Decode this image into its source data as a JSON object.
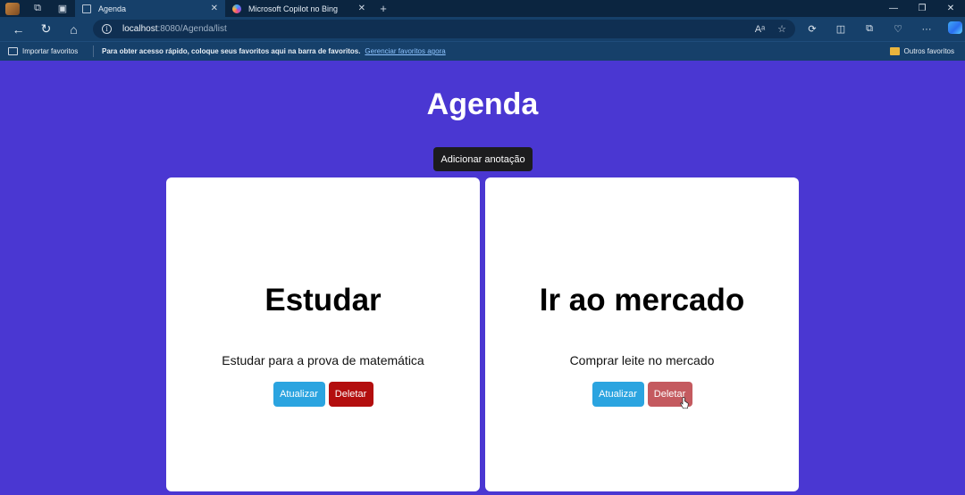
{
  "browser": {
    "tabs": [
      {
        "title": "Agenda",
        "active": true
      },
      {
        "title": "Microsoft Copilot no Bing",
        "active": false
      }
    ],
    "address": {
      "host": "localhost",
      "path": ":8080/Agenda/list"
    },
    "favorites_bar": {
      "import_label": "Importar favoritos",
      "message": "Para obter acesso rápido, coloque seus favoritos aqui na barra de favoritos.",
      "manage_link": "Gerenciar favoritos agora",
      "other_label": "Outros favoritos"
    }
  },
  "page": {
    "title": "Agenda",
    "add_button": "Adicionar anotação",
    "notes": [
      {
        "title": "Estudar",
        "description": "Estudar para a prova de matemática",
        "update_label": "Atualizar",
        "delete_label": "Deletar"
      },
      {
        "title": "Ir ao mercado",
        "description": "Comprar leite no mercado",
        "update_label": "Atualizar",
        "delete_label": "Deletar"
      }
    ]
  },
  "colors": {
    "page_background": "#4a37d2",
    "update_button": "#2ba4e0",
    "delete_button": "#b30e0e",
    "delete_button_hover": "#c45a5f"
  }
}
